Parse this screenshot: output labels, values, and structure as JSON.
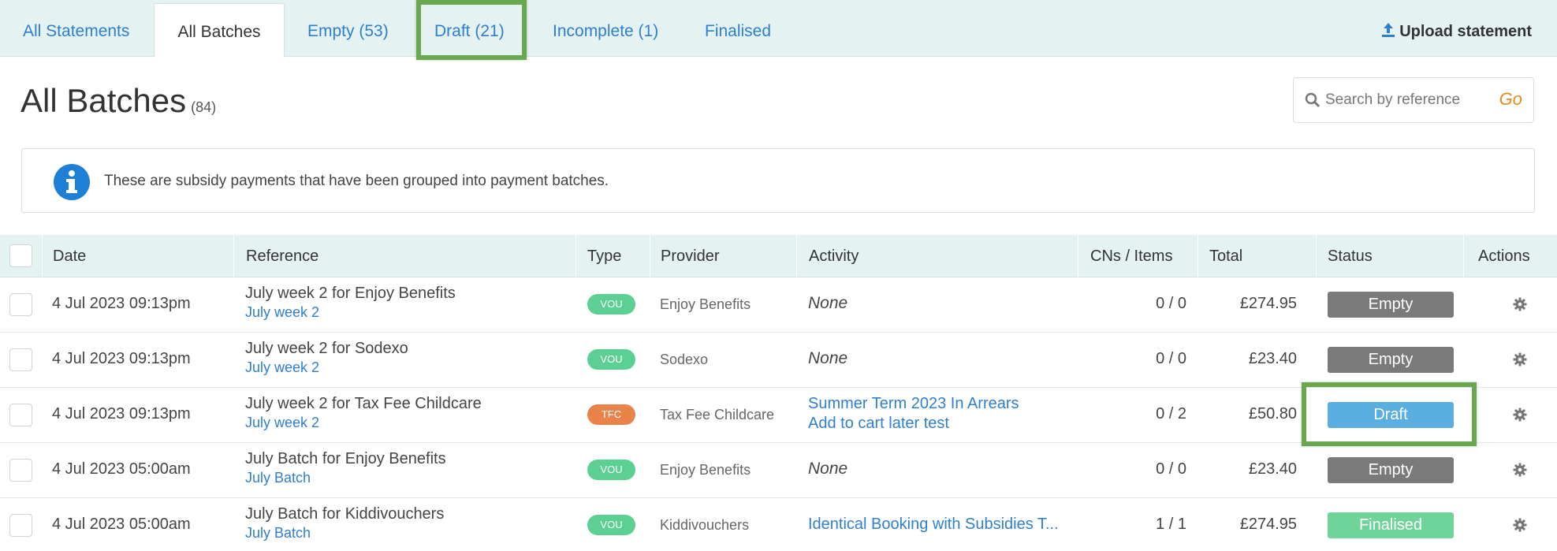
{
  "tabs": [
    {
      "label": "All Statements"
    },
    {
      "label": "All Batches"
    },
    {
      "label": "Empty (53)"
    },
    {
      "label": "Draft (21)"
    },
    {
      "label": "Incomplete (1)"
    },
    {
      "label": "Finalised"
    }
  ],
  "upload_label": "Upload statement",
  "page_title": "All Batches",
  "page_count": "(84)",
  "search": {
    "placeholder": "Search by reference",
    "go_label": "Go"
  },
  "info_text": "These are subsidy payments that have been grouped into payment batches.",
  "columns": {
    "date": "Date",
    "reference": "Reference",
    "type": "Type",
    "provider": "Provider",
    "activity": "Activity",
    "cns_items": "CNs / Items",
    "total": "Total",
    "status": "Status",
    "actions": "Actions"
  },
  "rows": [
    {
      "date": "4 Jul 2023 09:13pm",
      "ref": "July week 2 for Enjoy Benefits",
      "ref_sub": "July week 2",
      "type": "VOU",
      "provider": "Enjoy Benefits",
      "activity": [
        "None"
      ],
      "activity_none": true,
      "cns": "0 / 0",
      "total": "£274.95",
      "status": "Empty"
    },
    {
      "date": "4 Jul 2023 09:13pm",
      "ref": "July week 2 for Sodexo",
      "ref_sub": "July week 2",
      "type": "VOU",
      "provider": "Sodexo",
      "activity": [
        "None"
      ],
      "activity_none": true,
      "cns": "0 / 0",
      "total": "£23.40",
      "status": "Empty"
    },
    {
      "date": "4 Jul 2023 09:13pm",
      "ref": "July week 2 for Tax Fee Childcare",
      "ref_sub": "July week 2",
      "type": "TFC",
      "provider": "Tax Fee Childcare",
      "activity": [
        "Summer Term 2023 In Arrears",
        "Add to cart later test"
      ],
      "activity_none": false,
      "cns": "0 / 2",
      "total": "£50.80",
      "status": "Draft"
    },
    {
      "date": "4 Jul 2023 05:00am",
      "ref": "July Batch for Enjoy Benefits",
      "ref_sub": "July Batch",
      "type": "VOU",
      "provider": "Enjoy Benefits",
      "activity": [
        "None"
      ],
      "activity_none": true,
      "cns": "0 / 0",
      "total": "£23.40",
      "status": "Empty"
    },
    {
      "date": "4 Jul 2023 05:00am",
      "ref": "July Batch for Kiddivouchers",
      "ref_sub": "July Batch",
      "type": "VOU",
      "provider": "Kiddivouchers",
      "activity": [
        "Identical Booking with Subsidies T..."
      ],
      "activity_none": false,
      "cns": "1 / 1",
      "total": "£274.95",
      "status": "Finalised"
    }
  ],
  "colors": {
    "tab_bar_bg": "#e4f2f2",
    "link": "#2f7fcf",
    "highlight": "#6aa84f",
    "badge_vou": "#5ccf93",
    "badge_tfc": "#e8834a",
    "status_empty": "#7a7a7a",
    "status_draft": "#5aaee0",
    "status_finalised": "#6fd49a",
    "go": "#e98a1c",
    "info_icon": "#1e7fd6"
  }
}
